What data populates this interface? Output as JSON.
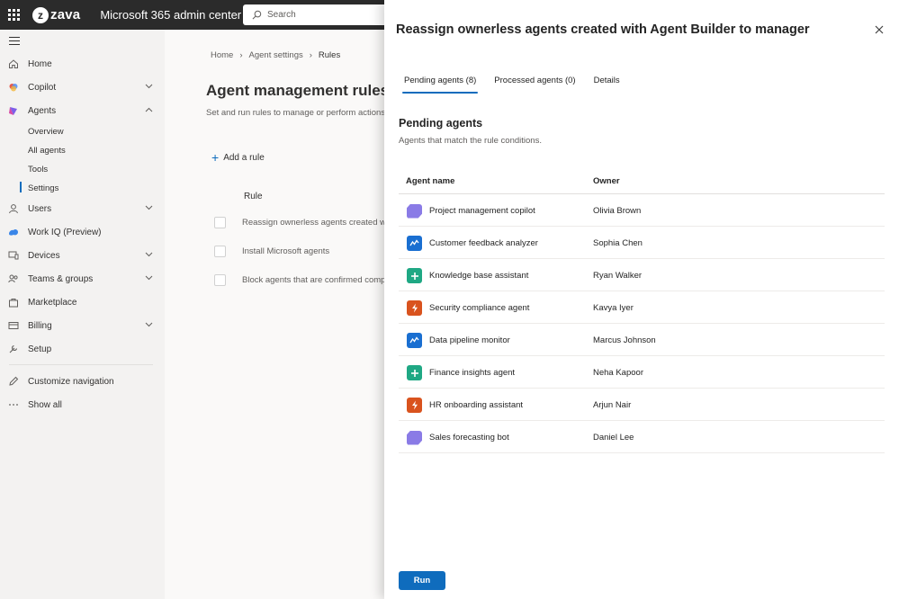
{
  "header": {
    "brand": "zava",
    "app_title": "Microsoft 365 admin center",
    "search_placeholder": "Search"
  },
  "nav": {
    "items": [
      {
        "label": "Home",
        "icon": "home-icon"
      },
      {
        "label": "Copilot",
        "icon": "copilot-icon",
        "expandable": true
      },
      {
        "label": "Agents",
        "icon": "agents-icon",
        "expanded": true
      },
      {
        "label": "Users",
        "icon": "user-icon",
        "expandable": true
      },
      {
        "label": "Work IQ (Preview)",
        "icon": "workiq-icon"
      },
      {
        "label": "Devices",
        "icon": "devices-icon",
        "expandable": true
      },
      {
        "label": "Teams & groups",
        "icon": "teams-icon",
        "expandable": true
      },
      {
        "label": "Marketplace",
        "icon": "marketplace-icon"
      },
      {
        "label": "Billing",
        "icon": "billing-icon",
        "expandable": true
      },
      {
        "label": "Setup",
        "icon": "setup-icon"
      },
      {
        "label": "Customize navigation",
        "icon": "pencil-icon"
      },
      {
        "label": "Show all",
        "icon": "more-icon"
      }
    ],
    "agents_sub": [
      "Overview",
      "All agents",
      "Tools",
      "Settings"
    ],
    "active_sub": "Settings"
  },
  "page": {
    "breadcrumb": [
      "Home",
      "Agent settings",
      "Rules"
    ],
    "title": "Agent management rules",
    "description": "Set and run rules to manage or perform actions o",
    "add_rule": "Add a rule",
    "column_rule": "Rule",
    "rules": [
      "Reassign ownerless agents created wit",
      "Install Microsoft agents",
      "Block agents that are confirmed comp"
    ]
  },
  "panel": {
    "title": "Reassign ownerless agents created with Agent Builder to manager",
    "tabs": [
      "Pending agents (8)",
      "Processed agents (0)",
      "Details"
    ],
    "active_tab": "Pending agents (8)",
    "section_title": "Pending agents",
    "section_subtitle": "Agents that match the rule conditions.",
    "columns": {
      "name": "Agent name",
      "owner": "Owner"
    },
    "agents": [
      {
        "name": "Project management copilot",
        "owner": "Olivia Brown",
        "icon": "purple-hex-icon",
        "color": "#8a7be6"
      },
      {
        "name": "Customer feedback analyzer",
        "owner": "Sophia Chen",
        "icon": "chart-icon",
        "color": "#1a6fd1"
      },
      {
        "name": "Knowledge base assistant",
        "owner": "Ryan Walker",
        "icon": "plus-icon",
        "color": "#1fa884"
      },
      {
        "name": "Security compliance agent",
        "owner": "Kavya Iyer",
        "icon": "lightning-icon",
        "color": "#d9531e"
      },
      {
        "name": "Data pipeline monitor",
        "owner": "Marcus Johnson",
        "icon": "chart-icon",
        "color": "#1a6fd1"
      },
      {
        "name": "Finance insights agent",
        "owner": "Neha Kapoor",
        "icon": "plus-icon",
        "color": "#1fa884"
      },
      {
        "name": "HR onboarding assistant",
        "owner": "Arjun Nair",
        "icon": "lightning-icon",
        "color": "#d9531e"
      },
      {
        "name": "Sales forecasting bot",
        "owner": "Daniel Lee",
        "icon": "purple-hex-icon",
        "color": "#8a7be6"
      }
    ],
    "run_label": "Run"
  }
}
